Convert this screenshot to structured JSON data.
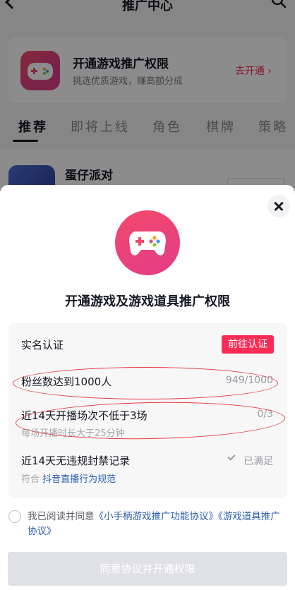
{
  "nav": {
    "title": "推广中心",
    "back_icon": "chevron-left-icon",
    "search_icon": "search-icon"
  },
  "promo_card": {
    "title": "开通游戏推广权限",
    "subtitle": "挑选优质游戏，赚高额分成",
    "action": "去开通",
    "action_chevron": "›",
    "icon": "gamepad-icon"
  },
  "tabs": [
    "推荐",
    "即将上线",
    "角色",
    "棋牌",
    "策略"
  ],
  "game_row": {
    "name": "蛋仔派对"
  },
  "sheet": {
    "icon": "gamepad-icon",
    "title": "开通游戏及游戏道具推广权限",
    "requirements": [
      {
        "label": "实名认证",
        "button": "前往认证"
      },
      {
        "label": "粉丝数达到1000人",
        "value": "949/1000"
      },
      {
        "label": "近14天开播场次不低于3场",
        "value": "0/3",
        "sub": "每场开播时长大于25分钟"
      },
      {
        "label": "近14天无违规封禁记录",
        "value": "已满足",
        "sub_prefix": "符合",
        "sub_link": "抖音直播行为规范"
      }
    ],
    "agreement": {
      "prefix": "我已阅读并同意",
      "link1": "《小手柄游戏推广功能协议》",
      "link2": "《游戏道具推广协议》"
    },
    "submit": "同意协议并开通权限"
  },
  "colors": {
    "accent": "#fe2c55",
    "link": "#2a5db0",
    "annotation": "#e6383c",
    "disabled": "#e0e1e4"
  }
}
